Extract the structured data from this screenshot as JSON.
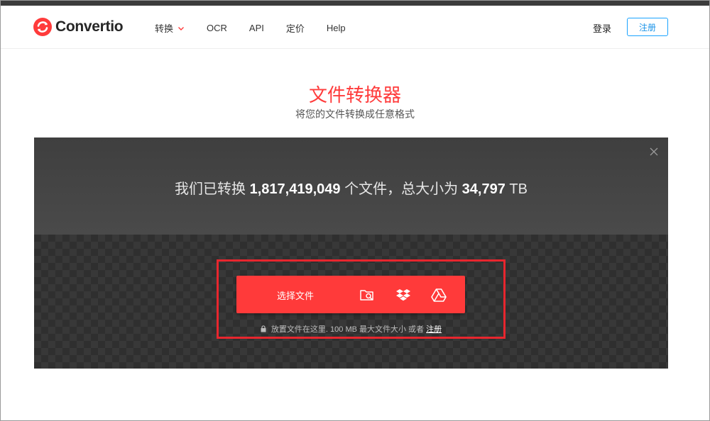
{
  "header": {
    "logo_text": "Convertio",
    "nav": [
      {
        "label": "转换",
        "has_dropdown": true
      },
      {
        "label": "OCR"
      },
      {
        "label": "API"
      },
      {
        "label": "定价"
      },
      {
        "label": "Help"
      }
    ],
    "login_label": "登录",
    "signup_label": "注册"
  },
  "hero": {
    "title": "文件转换器",
    "subtitle": "将您的文件转换成任意格式"
  },
  "stats": {
    "prefix": "我们已转换",
    "files_count": "1,817,419,049",
    "mid": "个文件，总大小为",
    "total_size": "34,797",
    "unit": "TB"
  },
  "upload": {
    "choose_label": "选择文件",
    "icons": [
      "folder-search-icon",
      "dropbox-icon",
      "google-drive-icon"
    ],
    "note_text": "放置文件在这里. 100 MB 最大文件大小 或者",
    "note_link": "注册"
  },
  "colors": {
    "brand_red": "#ff3a3a",
    "highlight_red": "#e8262e",
    "signup_blue": "#1aa3ff",
    "panel_dark": "#2f2f2f"
  }
}
